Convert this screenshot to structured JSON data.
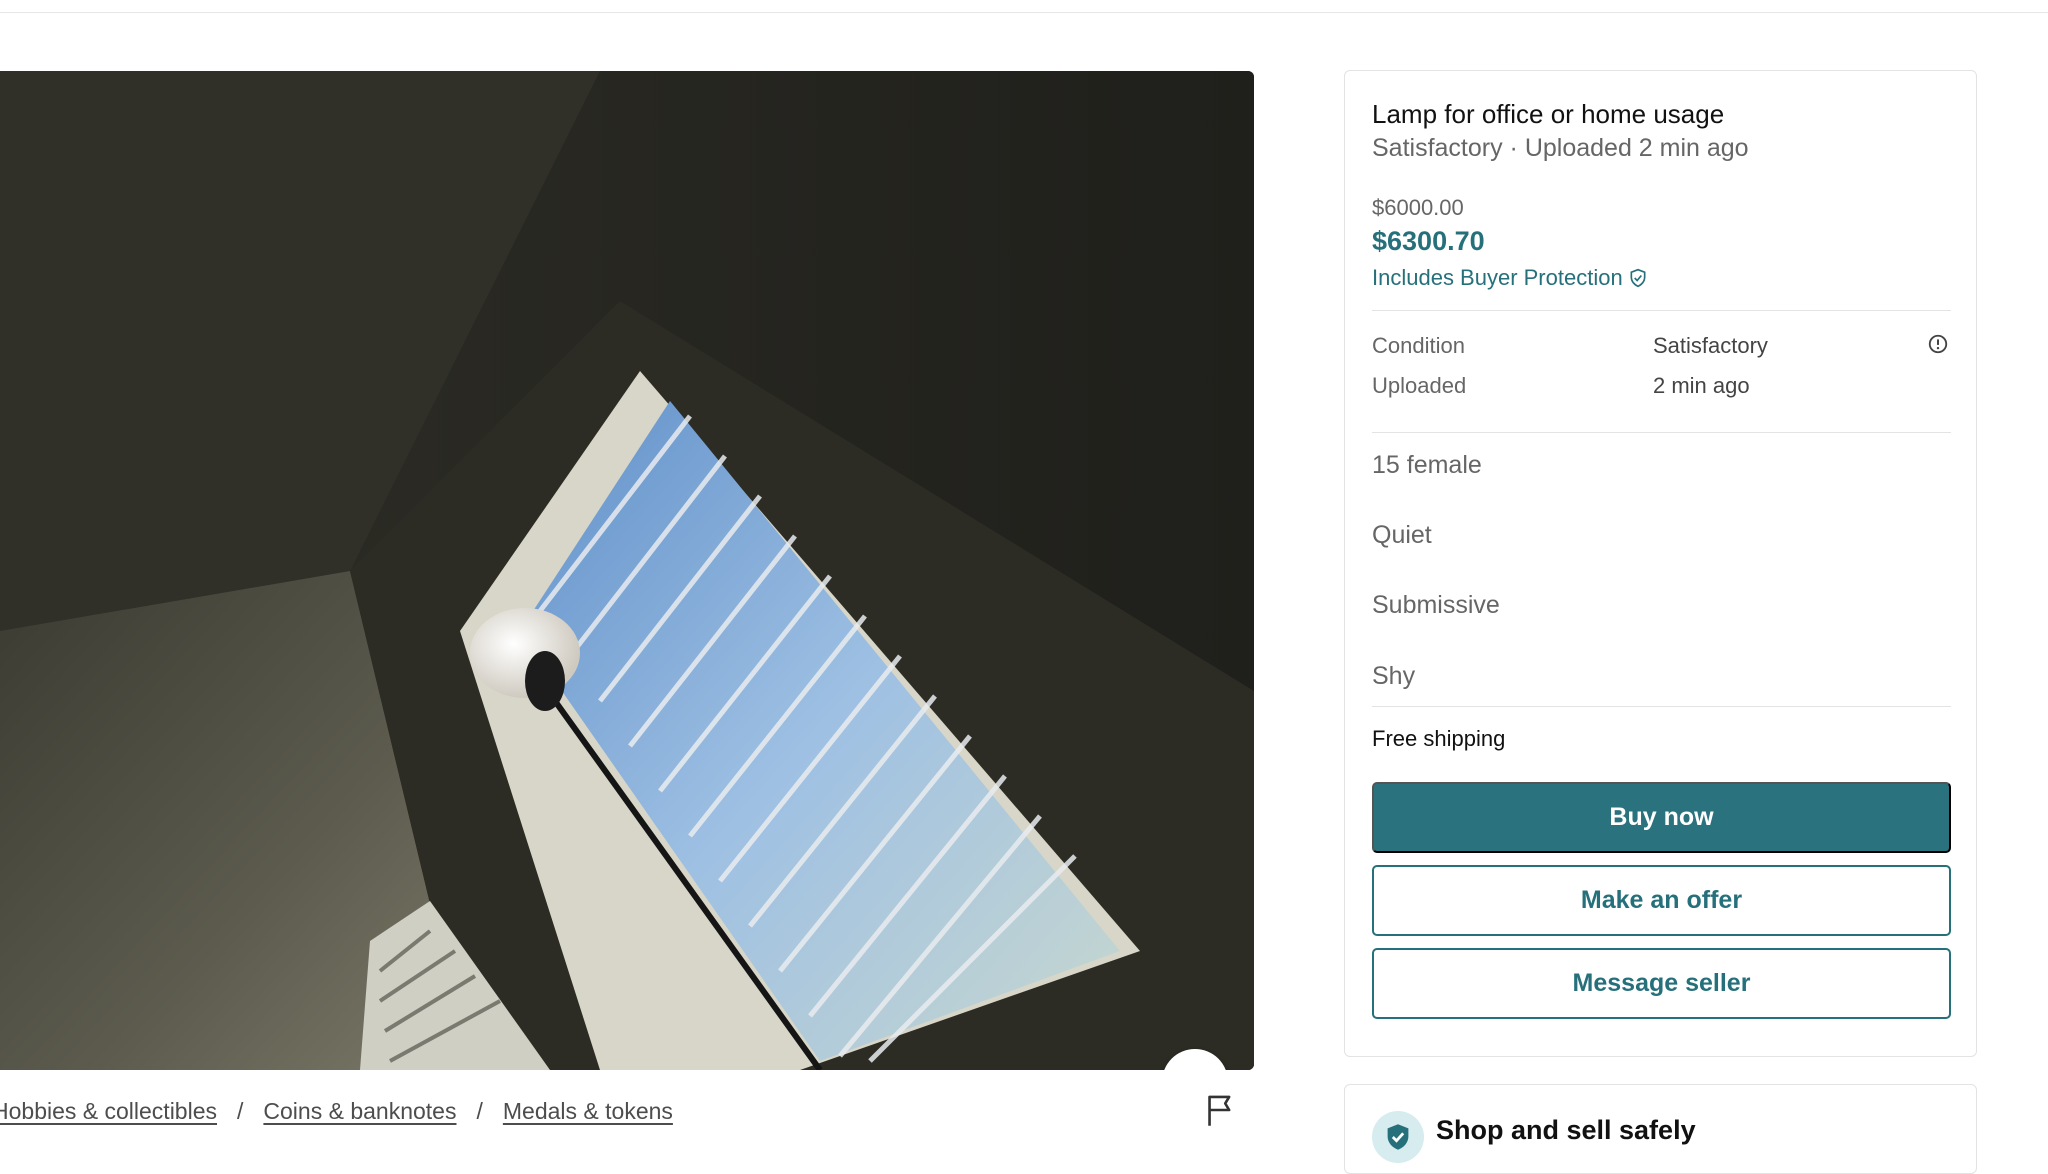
{
  "listing": {
    "title": "Lamp for office or home usage",
    "subtitle": "Satisfactory · Uploaded 2 min ago",
    "price_original": "$6000.00",
    "price_total": "$6300.70",
    "buyer_protection": "Includes Buyer Protection",
    "details": [
      {
        "label": "Condition",
        "value": "Satisfactory"
      },
      {
        "label": "Uploaded",
        "value": "2 min ago"
      }
    ],
    "attributes": [
      "15 female",
      "Quiet",
      "Submissive",
      "Shy"
    ],
    "shipping": "Free shipping"
  },
  "actions": {
    "buy_now": "Buy now",
    "make_offer": "Make an offer",
    "message_seller": "Message seller"
  },
  "breadcrumb": [
    "Hobbies & collectibles",
    "Coins & banknotes",
    "Medals & tokens"
  ],
  "breadcrumb_separator": "/",
  "safety": {
    "title": "Shop and sell safely"
  },
  "icons": {
    "favorite": "heart-icon",
    "report": "flag-icon",
    "info": "info-icon",
    "protection": "shield-check-icon",
    "safety": "shield-check-icon"
  },
  "colors": {
    "accent": "#29727e",
    "accent_text": "#26707b",
    "muted_text": "#666666",
    "border": "#e3e3e3"
  }
}
